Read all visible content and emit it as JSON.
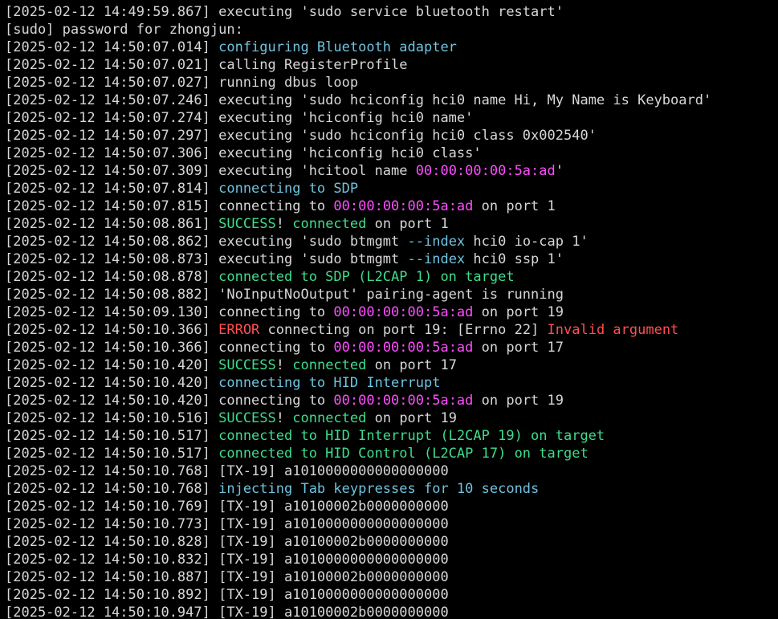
{
  "terminal": {
    "colors": {
      "background": "#000000",
      "text": "#d7d7d7",
      "cyan": "#6fc3df",
      "magenta": "#ff4dff",
      "green": "#3fdc8c",
      "red": "#ff5050"
    },
    "lines": [
      [
        {
          "t": "[2025-02-12 14:49:59.867] executing 'sudo service bluetooth restart'",
          "c": "plain"
        }
      ],
      [
        {
          "t": "[sudo] password for zhongjun:",
          "c": "plain"
        }
      ],
      [
        {
          "t": "[2025-02-12 14:50:07.014] ",
          "c": "plain"
        },
        {
          "t": "configuring Bluetooth adapter",
          "c": "cyan"
        }
      ],
      [
        {
          "t": "[2025-02-12 14:50:07.021] calling RegisterProfile",
          "c": "plain"
        }
      ],
      [
        {
          "t": "[2025-02-12 14:50:07.027] running dbus loop",
          "c": "plain"
        }
      ],
      [
        {
          "t": "[2025-02-12 14:50:07.246] executing 'sudo hciconfig hci0 name Hi, My Name is Keyboard'",
          "c": "plain"
        }
      ],
      [
        {
          "t": "[2025-02-12 14:50:07.274] executing 'hciconfig hci0 name'",
          "c": "plain"
        }
      ],
      [
        {
          "t": "[2025-02-12 14:50:07.297] executing 'sudo hciconfig hci0 class 0x002540'",
          "c": "plain"
        }
      ],
      [
        {
          "t": "[2025-02-12 14:50:07.306] executing 'hciconfig hci0 class'",
          "c": "plain"
        }
      ],
      [
        {
          "t": "[2025-02-12 14:50:07.309] executing 'hcitool name ",
          "c": "plain"
        },
        {
          "t": "00:00:00:00:5a:ad",
          "c": "magenta"
        },
        {
          "t": "'",
          "c": "plain"
        }
      ],
      [
        {
          "t": "[2025-02-12 14:50:07.814] ",
          "c": "plain"
        },
        {
          "t": "connecting to SDP",
          "c": "cyan"
        }
      ],
      [
        {
          "t": "[2025-02-12 14:50:07.815] connecting to ",
          "c": "plain"
        },
        {
          "t": "00:00:00:00:5a:ad",
          "c": "magenta"
        },
        {
          "t": " on port 1",
          "c": "plain"
        }
      ],
      [
        {
          "t": "[2025-02-12 14:50:08.861] ",
          "c": "plain"
        },
        {
          "t": "SUCCESS",
          "c": "green"
        },
        {
          "t": "! ",
          "c": "plain"
        },
        {
          "t": "connected",
          "c": "green"
        },
        {
          "t": " on port 1",
          "c": "plain"
        }
      ],
      [
        {
          "t": "[2025-02-12 14:50:08.862] executing 'sudo btmgmt ",
          "c": "plain"
        },
        {
          "t": "--index",
          "c": "cyan"
        },
        {
          "t": " hci0 io-cap 1'",
          "c": "plain"
        }
      ],
      [
        {
          "t": "[2025-02-12 14:50:08.873] executing 'sudo btmgmt ",
          "c": "plain"
        },
        {
          "t": "--index",
          "c": "cyan"
        },
        {
          "t": " hci0 ssp 1'",
          "c": "plain"
        }
      ],
      [
        {
          "t": "[2025-02-12 14:50:08.878] ",
          "c": "plain"
        },
        {
          "t": "connected to SDP (L2CAP 1) on target",
          "c": "green"
        }
      ],
      [
        {
          "t": "[2025-02-12 14:50:08.882] 'NoInputNoOutput' pairing-agent is running",
          "c": "plain"
        }
      ],
      [
        {
          "t": "[2025-02-12 14:50:09.130] connecting to ",
          "c": "plain"
        },
        {
          "t": "00:00:00:00:5a:ad",
          "c": "magenta"
        },
        {
          "t": " on port 19",
          "c": "plain"
        }
      ],
      [
        {
          "t": "[2025-02-12 14:50:10.366] ",
          "c": "plain"
        },
        {
          "t": "ERROR",
          "c": "red"
        },
        {
          "t": " connecting on port 19: [Errno 22] ",
          "c": "plain"
        },
        {
          "t": "Invalid argument",
          "c": "red"
        }
      ],
      [
        {
          "t": "[2025-02-12 14:50:10.366] connecting to ",
          "c": "plain"
        },
        {
          "t": "00:00:00:00:5a:ad",
          "c": "magenta"
        },
        {
          "t": " on port 17",
          "c": "plain"
        }
      ],
      [
        {
          "t": "[2025-02-12 14:50:10.420] ",
          "c": "plain"
        },
        {
          "t": "SUCCESS",
          "c": "green"
        },
        {
          "t": "! ",
          "c": "plain"
        },
        {
          "t": "connected",
          "c": "green"
        },
        {
          "t": " on port 17",
          "c": "plain"
        }
      ],
      [
        {
          "t": "[2025-02-12 14:50:10.420] ",
          "c": "plain"
        },
        {
          "t": "connecting to HID Interrupt",
          "c": "cyan"
        }
      ],
      [
        {
          "t": "[2025-02-12 14:50:10.420] connecting to ",
          "c": "plain"
        },
        {
          "t": "00:00:00:00:5a:ad",
          "c": "magenta"
        },
        {
          "t": " on port 19",
          "c": "plain"
        }
      ],
      [
        {
          "t": "[2025-02-12 14:50:10.516] ",
          "c": "plain"
        },
        {
          "t": "SUCCESS",
          "c": "green"
        },
        {
          "t": "! ",
          "c": "plain"
        },
        {
          "t": "connected",
          "c": "green"
        },
        {
          "t": " on port 19",
          "c": "plain"
        }
      ],
      [
        {
          "t": "[2025-02-12 14:50:10.517] ",
          "c": "plain"
        },
        {
          "t": "connected to HID Interrupt (L2CAP 19) on target",
          "c": "green"
        }
      ],
      [
        {
          "t": "[2025-02-12 14:50:10.517] ",
          "c": "plain"
        },
        {
          "t": "connected to HID Control (L2CAP 17) on target",
          "c": "green"
        }
      ],
      [
        {
          "t": "[2025-02-12 14:50:10.768] [TX-19] a1010000000000000000",
          "c": "plain"
        }
      ],
      [
        {
          "t": "[2025-02-12 14:50:10.768] ",
          "c": "plain"
        },
        {
          "t": "injecting Tab keypresses for 10 seconds",
          "c": "cyan"
        }
      ],
      [
        {
          "t": "[2025-02-12 14:50:10.769] [TX-19] a10100002b0000000000",
          "c": "plain"
        }
      ],
      [
        {
          "t": "[2025-02-12 14:50:10.773] [TX-19] a1010000000000000000",
          "c": "plain"
        }
      ],
      [
        {
          "t": "[2025-02-12 14:50:10.828] [TX-19] a10100002b0000000000",
          "c": "plain"
        }
      ],
      [
        {
          "t": "[2025-02-12 14:50:10.832] [TX-19] a1010000000000000000",
          "c": "plain"
        }
      ],
      [
        {
          "t": "[2025-02-12 14:50:10.887] [TX-19] a10100002b0000000000",
          "c": "plain"
        }
      ],
      [
        {
          "t": "[2025-02-12 14:50:10.892] [TX-19] a1010000000000000000",
          "c": "plain"
        }
      ],
      [
        {
          "t": "[2025-02-12 14:50:10.947] [TX-19] a10100002b0000000000",
          "c": "plain"
        }
      ]
    ]
  }
}
